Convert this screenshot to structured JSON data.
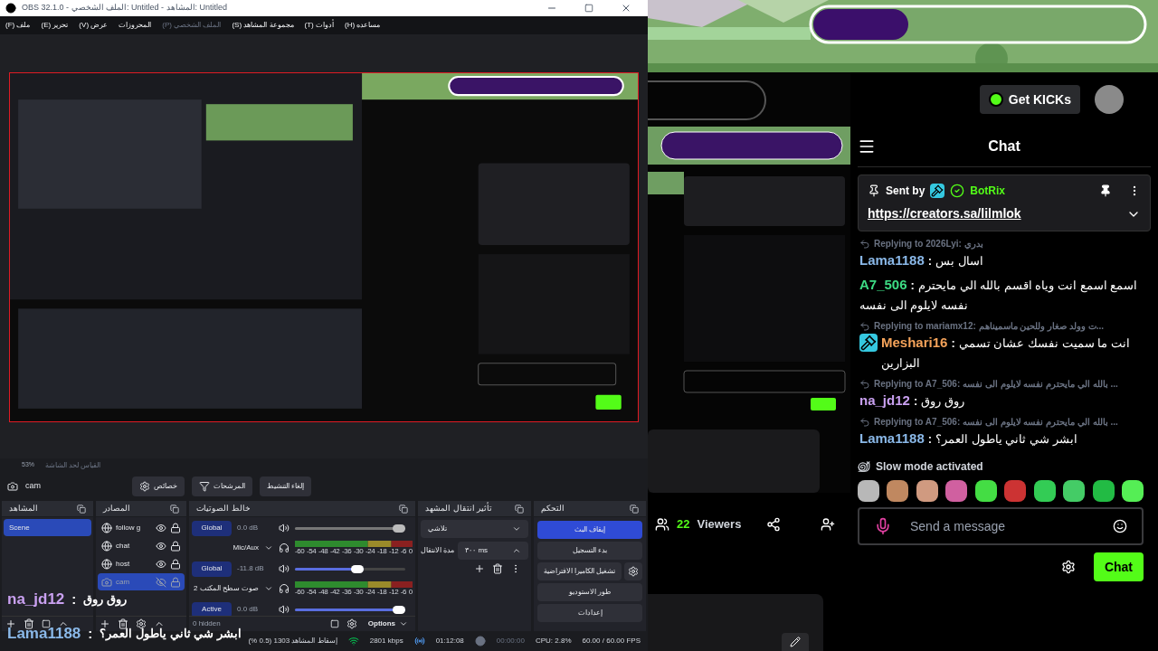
{
  "obs": {
    "title": "OBS 32.1.0 - الملف الشخصي: Untitled - المشاهد: Untitled",
    "menu": [
      {
        "label": "مساعده (H)",
        "disabled": false
      },
      {
        "label": "أدوات (T)",
        "disabled": false
      },
      {
        "label": "مجموعة المشاهد (S)",
        "disabled": false
      },
      {
        "label": "الملف الشخصي (P)",
        "disabled": true
      },
      {
        "label": "المحروزات",
        "disabled": false
      },
      {
        "label": "عرض (V)",
        "disabled": false
      },
      {
        "label": "تحرير (E)",
        "disabled": false
      },
      {
        "label": "ملف (F)",
        "disabled": false
      }
    ],
    "zoom": "53%",
    "zoom_label": "القياس لحد الشاشة",
    "context": {
      "source": "cam",
      "buttons": [
        {
          "kind": "plain",
          "label": "إلغاء التنشيط"
        },
        {
          "kind": "filters",
          "label": "المرشحات"
        },
        {
          "kind": "properties",
          "label": "خصائص"
        }
      ]
    },
    "scenes": {
      "title": "المشاهد",
      "items": [
        {
          "name": "Scene",
          "selected": true
        }
      ]
    },
    "sources": {
      "title": "المصادر",
      "items": [
        {
          "name": "follow g",
          "kind": "browser",
          "visible": true,
          "selected": false
        },
        {
          "name": "chat",
          "kind": "browser",
          "visible": true,
          "selected": false
        },
        {
          "name": "host",
          "kind": "browser",
          "visible": true,
          "selected": false
        },
        {
          "name": "cam",
          "kind": "camera",
          "visible": false,
          "selected": true
        }
      ]
    },
    "mixer": {
      "title": "خالط الصوتيات",
      "hidden": "0 hidden",
      "options": "Options",
      "channels": [
        {
          "button": "Global",
          "db": "0.0 dB",
          "name": "Mic/Aux",
          "active": false,
          "level": 1.0,
          "scale": [
            "0",
            "-6",
            "-12",
            "-18",
            "-24",
            "-30",
            "-36",
            "-42",
            "-48",
            "-54",
            "-60"
          ]
        },
        {
          "button": "Global",
          "db": "-11.8 dB",
          "name": "صوت سطح المكتب 2",
          "active": true,
          "level": 0.62,
          "scale": [
            "0",
            "-6",
            "-12",
            "-18",
            "-24",
            "-30",
            "-36",
            "-42",
            "-48",
            "-54",
            "-60"
          ]
        },
        {
          "button": "Active",
          "db": "0.0 dB",
          "active": true,
          "level": 1.0
        }
      ]
    },
    "transitions": {
      "title": "تأثير انتقال المشهد",
      "effect": "تلاشي",
      "duration_label": "مدة الانتقال",
      "duration": "٣٠٠ ms"
    },
    "controls": {
      "title": "التحكم",
      "buttons": [
        {
          "label": "إيقاف البث",
          "selected": true,
          "settings": false
        },
        {
          "label": "بدء التسجيل",
          "selected": false,
          "settings": false
        },
        {
          "label": "تشغيل الكاميرا الافتراضية",
          "selected": false,
          "settings": true
        },
        {
          "label": "طور الاستوديو",
          "selected": false,
          "settings": false
        },
        {
          "label": "إعدادات",
          "selected": false,
          "settings": false
        }
      ]
    },
    "status": {
      "dropped": "إسقاط المشاهد 1303 (0.5 %)",
      "bitrate": "2801 kbps",
      "stream_time": "01:12:08",
      "record_time": "00:00:00",
      "cpu": "CPU: 2.8%",
      "fps": "60.00 / 60.00 FPS"
    }
  },
  "overlay_captions": [
    {
      "user": "na_jd12",
      "sep": ":",
      "text": "روق روق",
      "color": "#c9a0f0"
    },
    {
      "user": "Lama1188",
      "sep": ":",
      "text": "ابشر شي ثاني ياطول العمر؟",
      "color": "#8ab8e8"
    }
  ],
  "kick": {
    "get_kicks": "Get KICKs",
    "viewers": "22",
    "viewers_label": "Viewers",
    "chat_title": "Chat",
    "pinned": {
      "sent_by": "Sent by",
      "author": "BotRix",
      "link": "https://creators.sa/lilmlok"
    },
    "messages": [
      {
        "reply": "Replying to 2026Lyi: بدري",
        "user": "Lama1188",
        "sep": ":",
        "color": "#8ab8e8",
        "badge": false,
        "text": "اسال بس"
      },
      {
        "user": "A7_506",
        "sep": ":",
        "color": "#3ddc84",
        "badge": false,
        "text": "اسمع اسمع انت وياه اقسم بالله الي مايحترم نفسه لايلوم الى نفسه"
      },
      {
        "reply": "Replying to mariamx12: ت وولد صغار وللحين ماسميناهم...",
        "user": "Meshari16",
        "sep": ":",
        "color": "#f5a35a",
        "badge": true,
        "text": "انت ما سميت نفسك عشان تسمي البزارين"
      },
      {
        "reply": "Replying to A7_506: بالله الي مايحترم نفسه لايلوم الى نفسه ...",
        "user": "na_jd12",
        "sep": ":",
        "color": "#c9a0f0",
        "badge": false,
        "text": "روق روق"
      },
      {
        "reply": "Replying to A7_506: بالله الي مايحترم نفسه لايلوم الى نفسه ...",
        "user": "Lama1188",
        "sep": ":",
        "color": "#8ab8e8",
        "badge": false,
        "text": "ابشر شي ثاني ياطول العمر؟"
      }
    ],
    "slow_mode": "Slow mode activated",
    "emotes": [
      {
        "color": "#b8b8b8"
      },
      {
        "color": "#c08860"
      },
      {
        "color": "#d09a80"
      },
      {
        "color": "#d060a0"
      },
      {
        "color": "#44dd44"
      },
      {
        "color": "#cc3333"
      },
      {
        "color": "#33cc55"
      },
      {
        "color": "#44cc66"
      },
      {
        "color": "#22bb44"
      },
      {
        "color": "#55ee55"
      }
    ],
    "input_placeholder": "Send a message",
    "send": "Chat"
  }
}
